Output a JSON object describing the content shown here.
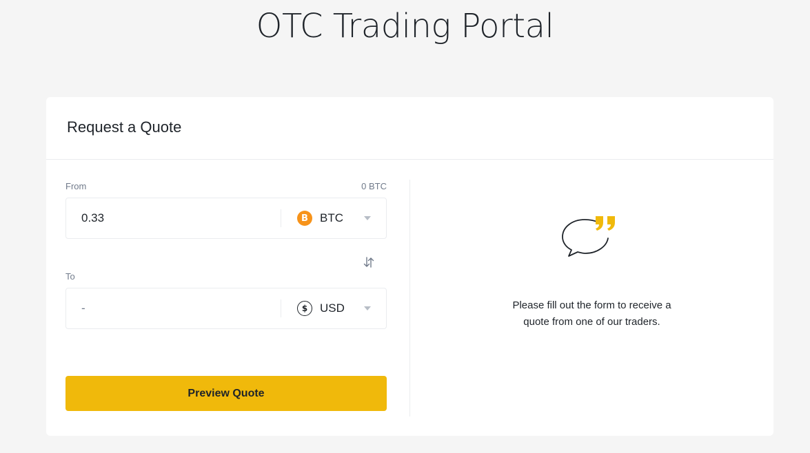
{
  "page": {
    "title": "OTC Trading Portal"
  },
  "quote_card": {
    "title": "Request a Quote",
    "from": {
      "label": "From",
      "balance": "0 BTC",
      "amount": "0.33",
      "currency": {
        "code": "BTC",
        "icon": "bitcoin-icon",
        "icon_glyph": "B"
      }
    },
    "to": {
      "label": "To",
      "amount": "-",
      "currency": {
        "code": "USD",
        "icon": "dollar-icon",
        "icon_glyph": "$"
      }
    },
    "swap_icon": "swap-arrows-icon",
    "submit_label": "Preview Quote",
    "info": {
      "icon": "speech-bubble-quote-icon",
      "message": "Please fill out the form to receive a quote from one of our traders."
    }
  },
  "colors": {
    "accent": "#f0b90b",
    "bitcoin": "#f7931a",
    "background": "#f5f5f5",
    "card": "#ffffff",
    "border": "#eaecef",
    "muted_text": "#707a8a",
    "text": "#1e2329"
  }
}
